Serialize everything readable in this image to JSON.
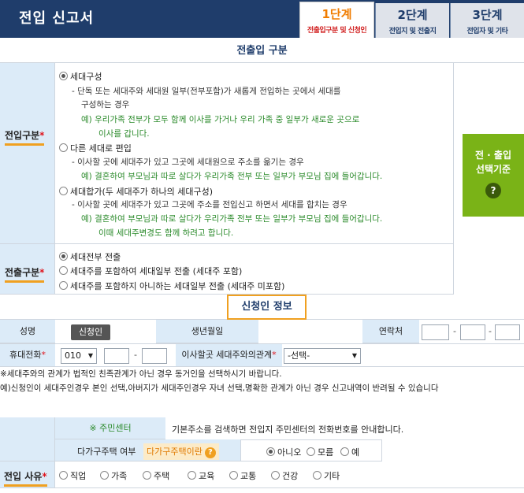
{
  "header": {
    "title": "전입 신고서",
    "steps": [
      {
        "num": "1단계",
        "sub": "전출입구분 및 신청인"
      },
      {
        "num": "2단계",
        "sub": "전입지 및 전출지"
      },
      {
        "num": "3단계",
        "sub": "전입자 및 기타"
      }
    ]
  },
  "section1": {
    "title": "전출입 구분",
    "move_in_type": {
      "label": "전입구분",
      "req": "*",
      "options": [
        {
          "label": "세대구성",
          "selected": true,
          "desc": [
            "- 단독 또는 세대주와 세대원 일부(전부포함)가 새롭게 전입하는 곳에서 세대를",
            "구성하는 경우"
          ],
          "ex": [
            "예) 우리가족 전부가 모두 함께 이사를 가거나 우리 가족 중 일부가 새로운 곳으로",
            "이사를 갑니다."
          ]
        },
        {
          "label": "다른 세대로 편입",
          "selected": false,
          "desc": [
            "- 이사할 곳에 세대주가 있고 그곳에 세대원으로 주소를 옮기는 경우"
          ],
          "ex": [
            "예) 결혼하여 부모님과 따로 살다가 우리가족 전부 또는 일부가 부모님 집에 들어갑니다."
          ]
        },
        {
          "label": "세대합가(두 세대주가 하나의 세대구성)",
          "selected": false,
          "desc": [
            "- 이사할 곳에 세대주가 있고 그곳에 주소를 전입신고 하면서 세대를 합치는 경우"
          ],
          "ex": [
            "예) 결혼하여 부모님과 따로 살다가 우리가족 전부 또는 일부가 부모님 집에 들어갑니다.",
            "이때 세대주변경도 함께 하려고 합니다."
          ]
        }
      ]
    },
    "criteria_button": {
      "line1": "전 · 출입",
      "line2": "선택기준",
      "icon": "?"
    },
    "move_out_type": {
      "label": "전출구분",
      "req": "*",
      "options": [
        {
          "label": "세대전부 전출",
          "selected": true
        },
        {
          "label": "세대주를 포함하여 세대일부 전출 (세대주 포함)",
          "selected": false
        },
        {
          "label": "세대주를 포함하지 아니하는 세대일부 전출 (세대주 미포함)",
          "selected": false
        }
      ]
    }
  },
  "section2": {
    "title": "신청인 정보",
    "name_label": "성명",
    "applicant_tag": "신청인",
    "birth_label": "생년월일",
    "contact_label": "연락처",
    "mobile_label": "휴대전화",
    "req": "*",
    "mobile_prefix": "010",
    "relation_label": "이사할곳 세대주와의관계",
    "relation_value": "-선택-",
    "notice1": "※세대주와의 관계가 법적인 친족관계가 아닌 경우 동거인을 선택하시기 바랍니다.",
    "notice2": "예)신청인이 세대주인경우 본인 선택,아버지가 세대주인경우 자녀 선택,명확한 관계가 아닌 경우 신고내역이 반려될 수 있습니다"
  },
  "section3": {
    "center_link": "※ 주민센터",
    "center_desc": "기본주소를 검색하면 전입지 주민센터의 전화번호를 안내합니다.",
    "multi_label": "다가구주택 여부",
    "multi_chip": "다가구주택이란",
    "multi_options": [
      {
        "label": "아니오",
        "selected": true
      },
      {
        "label": "모름",
        "selected": false
      },
      {
        "label": "예",
        "selected": false
      }
    ],
    "reason_label": "전입 사유",
    "req": "*",
    "reasons": [
      "직업",
      "가족",
      "주택",
      "교육",
      "교통",
      "건강",
      "기타"
    ]
  }
}
